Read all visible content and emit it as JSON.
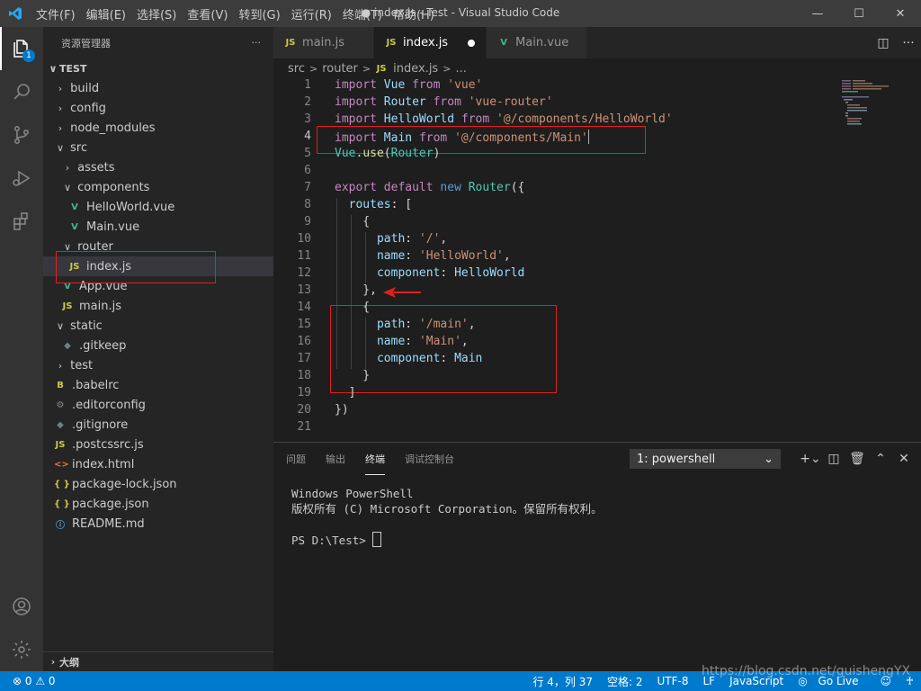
{
  "titlebar": {
    "menu": [
      "文件(F)",
      "编辑(E)",
      "选择(S)",
      "查看(V)",
      "转到(G)",
      "运行(R)",
      "终端(T)",
      "帮助(H)"
    ],
    "title": "● index.js - Test - Visual Studio Code"
  },
  "activity": {
    "explorer_badge": "1"
  },
  "explorer": {
    "title": "资源管理器",
    "more": "···",
    "root": "TEST",
    "items": [
      {
        "label": "build",
        "kind": "folder",
        "expanded": false
      },
      {
        "label": "config",
        "kind": "folder",
        "expanded": false
      },
      {
        "label": "node_modules",
        "kind": "folder",
        "expanded": false
      },
      {
        "label": "src",
        "kind": "folder",
        "expanded": true
      },
      {
        "label": "assets",
        "kind": "folder",
        "expanded": false
      },
      {
        "label": "components",
        "kind": "folder",
        "expanded": true
      },
      {
        "label": "HelloWorld.vue",
        "kind": "vue"
      },
      {
        "label": "Main.vue",
        "kind": "vue"
      },
      {
        "label": "router",
        "kind": "folder",
        "expanded": true
      },
      {
        "label": "index.js",
        "kind": "js",
        "selected": true
      },
      {
        "label": "App.vue",
        "kind": "vue"
      },
      {
        "label": "main.js",
        "kind": "js"
      },
      {
        "label": "static",
        "kind": "folder",
        "expanded": true
      },
      {
        "label": ".gitkeep",
        "kind": "gitkeep"
      },
      {
        "label": "test",
        "kind": "folder",
        "expanded": false
      },
      {
        "label": ".babelrc",
        "kind": "babel"
      },
      {
        "label": ".editorconfig",
        "kind": "gear"
      },
      {
        "label": ".gitignore",
        "kind": "git"
      },
      {
        "label": ".postcssrc.js",
        "kind": "js"
      },
      {
        "label": "index.html",
        "kind": "html"
      },
      {
        "label": "package-lock.json",
        "kind": "json"
      },
      {
        "label": "package.json",
        "kind": "json"
      },
      {
        "label": "README.md",
        "kind": "md"
      }
    ],
    "outline": "大纲"
  },
  "tabs": [
    {
      "label": "main.js",
      "icon": "JS",
      "active": false,
      "modified": false
    },
    {
      "label": "index.js",
      "icon": "JS",
      "active": true,
      "modified": true
    },
    {
      "label": "Main.vue",
      "icon": "V",
      "active": false,
      "modified": false
    }
  ],
  "breadcrumb": [
    "src",
    "router",
    "index.js",
    "..."
  ],
  "editor": {
    "current_line": 4,
    "lines": [
      [
        [
          "kw",
          "import"
        ],
        [
          "pn",
          " "
        ],
        [
          "var",
          "Vue"
        ],
        [
          "pn",
          " "
        ],
        [
          "kw",
          "from"
        ],
        [
          "pn",
          " "
        ],
        [
          "str",
          "'vue'"
        ]
      ],
      [
        [
          "kw",
          "import"
        ],
        [
          "pn",
          " "
        ],
        [
          "var",
          "Router"
        ],
        [
          "pn",
          " "
        ],
        [
          "kw",
          "from"
        ],
        [
          "pn",
          " "
        ],
        [
          "str",
          "'vue-router'"
        ]
      ],
      [
        [
          "kw",
          "import"
        ],
        [
          "pn",
          " "
        ],
        [
          "var",
          "HelloWorld"
        ],
        [
          "pn",
          " "
        ],
        [
          "kw",
          "from"
        ],
        [
          "pn",
          " "
        ],
        [
          "str",
          "'@/components/HelloWorld'"
        ]
      ],
      [
        [
          "kw",
          "import"
        ],
        [
          "pn",
          " "
        ],
        [
          "var",
          "Main"
        ],
        [
          "pn",
          " "
        ],
        [
          "kw",
          "from"
        ],
        [
          "pn",
          " "
        ],
        [
          "str",
          "'@/components/Main'"
        ]
      ],
      [
        [
          "typ",
          "Vue"
        ],
        [
          "pn",
          "."
        ],
        [
          "fn",
          "use"
        ],
        [
          "pn",
          "("
        ],
        [
          "typ",
          "Router"
        ],
        [
          "pn",
          ")"
        ]
      ],
      [],
      [
        [
          "kw",
          "export"
        ],
        [
          "pn",
          " "
        ],
        [
          "kw",
          "default"
        ],
        [
          "pn",
          " "
        ],
        [
          "blue",
          "new"
        ],
        [
          "pn",
          " "
        ],
        [
          "typ",
          "Router"
        ],
        [
          "pn",
          "({"
        ]
      ],
      [
        [
          "pn",
          "  "
        ],
        [
          "var",
          "routes"
        ],
        [
          "pn",
          ": ["
        ]
      ],
      [
        [
          "pn",
          "    {"
        ]
      ],
      [
        [
          "pn",
          "      "
        ],
        [
          "var",
          "path"
        ],
        [
          "pn",
          ": "
        ],
        [
          "str",
          "'/'"
        ],
        [
          "pn",
          ","
        ]
      ],
      [
        [
          "pn",
          "      "
        ],
        [
          "var",
          "name"
        ],
        [
          "pn",
          ": "
        ],
        [
          "str",
          "'HelloWorld'"
        ],
        [
          "pn",
          ","
        ]
      ],
      [
        [
          "pn",
          "      "
        ],
        [
          "var",
          "component"
        ],
        [
          "pn",
          ": "
        ],
        [
          "var",
          "HelloWorld"
        ]
      ],
      [
        [
          "pn",
          "    },"
        ]
      ],
      [
        [
          "pn",
          "    {"
        ]
      ],
      [
        [
          "pn",
          "      "
        ],
        [
          "var",
          "path"
        ],
        [
          "pn",
          ": "
        ],
        [
          "str",
          "'/main'"
        ],
        [
          "pn",
          ","
        ]
      ],
      [
        [
          "pn",
          "      "
        ],
        [
          "var",
          "name"
        ],
        [
          "pn",
          ": "
        ],
        [
          "str",
          "'Main'"
        ],
        [
          "pn",
          ","
        ]
      ],
      [
        [
          "pn",
          "      "
        ],
        [
          "var",
          "component"
        ],
        [
          "pn",
          ": "
        ],
        [
          "var",
          "Main"
        ]
      ],
      [
        [
          "pn",
          "    }"
        ]
      ],
      [
        [
          "pn",
          "  ]"
        ]
      ],
      [
        [
          "pn",
          "})"
        ]
      ],
      []
    ]
  },
  "panel": {
    "tabs": [
      "问题",
      "输出",
      "终端",
      "调试控制台"
    ],
    "active_tab": "终端",
    "terminal_select": "1: powershell",
    "terminal_lines": [
      "Windows PowerShell",
      "版权所有 (C) Microsoft Corporation。保留所有权利。",
      "",
      "PS D:\\Test> "
    ]
  },
  "statusbar": {
    "errors": "0",
    "warnings": "0",
    "position": "行 4，列 37",
    "spaces": "空格: 2",
    "encoding": "UTF-8",
    "eol": "LF",
    "language": "JavaScript",
    "golive": "Go Live"
  },
  "watermark": "https://blog.csdn.net/guishengYX",
  "colors": {
    "accent": "#007acc",
    "annotation": "#e02020"
  }
}
